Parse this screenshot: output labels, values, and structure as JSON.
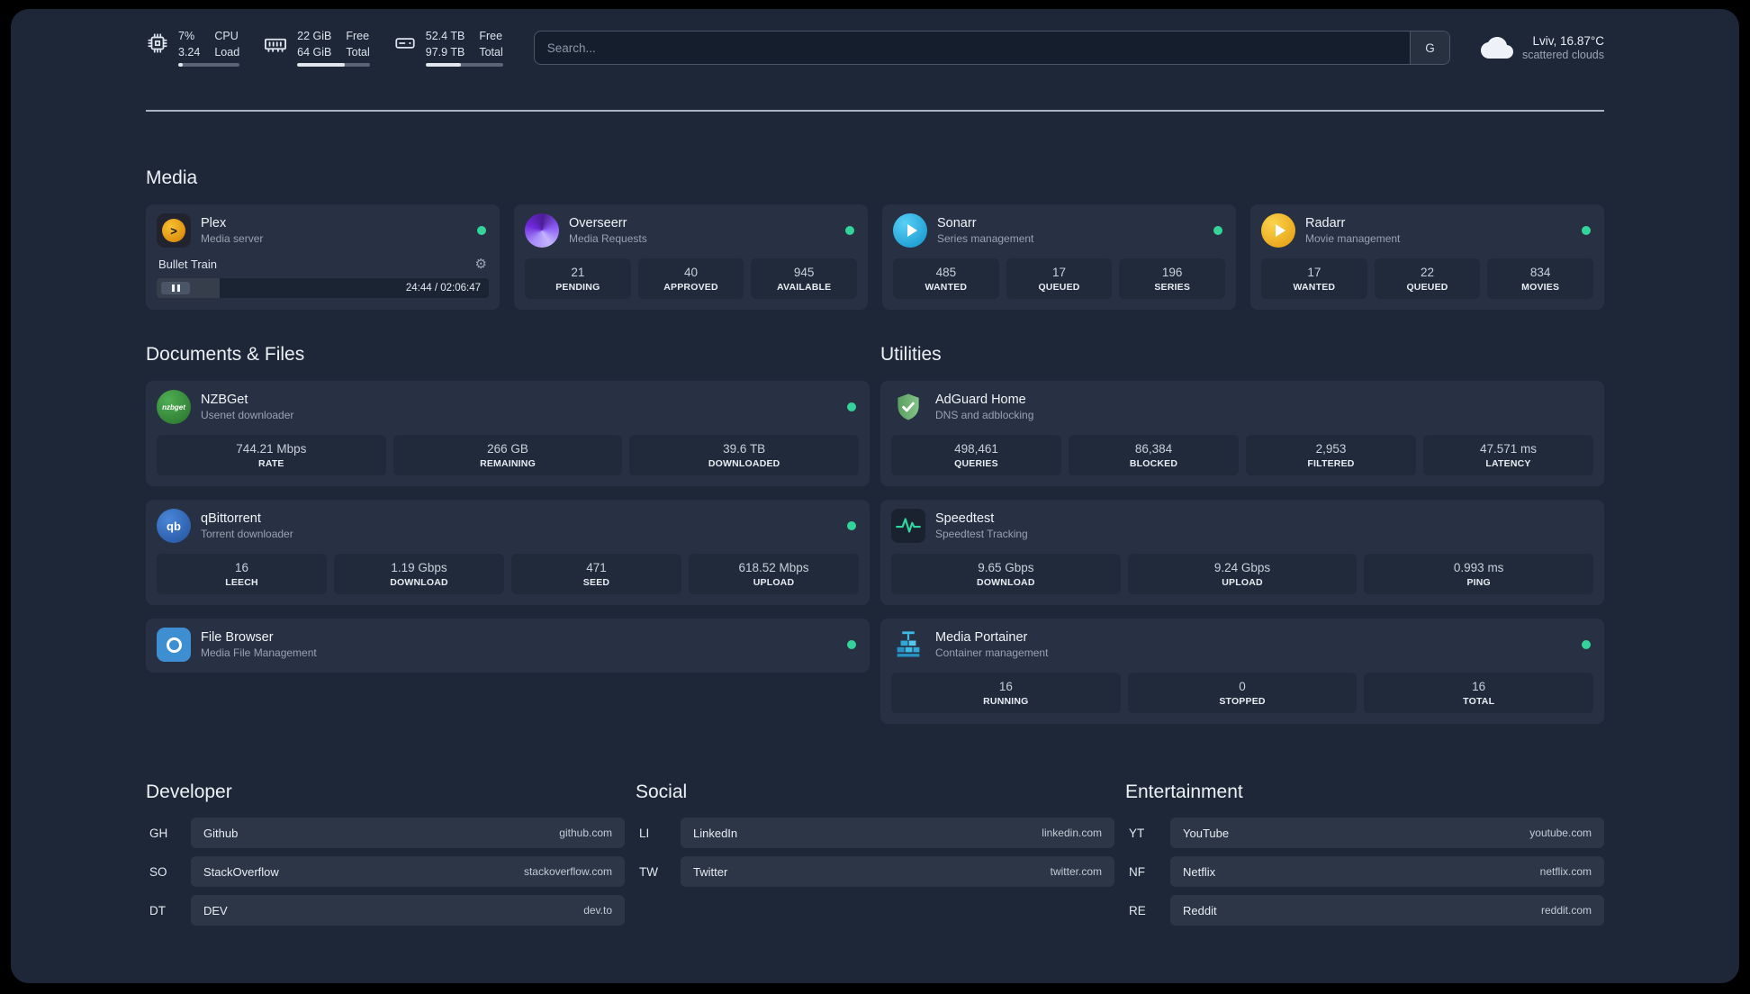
{
  "colors": {
    "status_online": "#34d399",
    "plex_accent": "#e5a00d",
    "overseerr_accent": "#7c3aed",
    "sonarr_accent": "#35c5f4",
    "radarr_accent": "#f7c51e",
    "nzbget_accent": "#43a047",
    "qbittorrent_accent": "#2f67ba",
    "filebrowser_accent": "#3d8fd1",
    "adguard_accent": "#68b279",
    "speedtest_accent": "#2fd6a2",
    "portainer_accent": "#3db9e5"
  },
  "topbar": {
    "cpu": {
      "value1": "7%",
      "value2": "3.24",
      "label1": "CPU",
      "label2": "Load",
      "bar_pct": 7
    },
    "memory": {
      "value1": "22 GiB",
      "value2": "64 GiB",
      "label1": "Free",
      "label2": "Total",
      "bar_pct": 66
    },
    "disk": {
      "value1": "52.4 TB",
      "value2": "97.9 TB",
      "label1": "Free",
      "label2": "Total",
      "bar_pct": 46
    },
    "search": {
      "placeholder": "Search...",
      "provider": "G"
    },
    "weather": {
      "location": "Lviv, 16.87°C",
      "condition": "scattered clouds"
    }
  },
  "media": {
    "title": "Media",
    "plex": {
      "name": "Plex",
      "desc": "Media server",
      "now_playing": "Bullet Train",
      "time": "24:44 / 02:06:47",
      "progress_pct": 19
    },
    "overseerr": {
      "name": "Overseerr",
      "desc": "Media Requests",
      "stats": [
        {
          "value": "21",
          "label": "PENDING"
        },
        {
          "value": "40",
          "label": "APPROVED"
        },
        {
          "value": "945",
          "label": "AVAILABLE"
        }
      ]
    },
    "sonarr": {
      "name": "Sonarr",
      "desc": "Series management",
      "stats": [
        {
          "value": "485",
          "label": "WANTED"
        },
        {
          "value": "17",
          "label": "QUEUED"
        },
        {
          "value": "196",
          "label": "SERIES"
        }
      ]
    },
    "radarr": {
      "name": "Radarr",
      "desc": "Movie management",
      "stats": [
        {
          "value": "17",
          "label": "WANTED"
        },
        {
          "value": "22",
          "label": "QUEUED"
        },
        {
          "value": "834",
          "label": "MOVIES"
        }
      ]
    }
  },
  "documents": {
    "title": "Documents & Files",
    "nzbget": {
      "name": "NZBGet",
      "desc": "Usenet downloader",
      "icon_text": "nzbget",
      "stats": [
        {
          "value": "744.21 Mbps",
          "label": "RATE"
        },
        {
          "value": "266 GB",
          "label": "REMAINING"
        },
        {
          "value": "39.6 TB",
          "label": "DOWNLOADED"
        }
      ]
    },
    "qbittorrent": {
      "name": "qBittorrent",
      "desc": "Torrent downloader",
      "icon_text": "qb",
      "stats": [
        {
          "value": "16",
          "label": "LEECH"
        },
        {
          "value": "1.19 Gbps",
          "label": "DOWNLOAD"
        },
        {
          "value": "471",
          "label": "SEED"
        },
        {
          "value": "618.52 Mbps",
          "label": "UPLOAD"
        }
      ]
    },
    "filebrowser": {
      "name": "File Browser",
      "desc": "Media File Management"
    }
  },
  "utilities": {
    "title": "Utilities",
    "adguard": {
      "name": "AdGuard Home",
      "desc": "DNS and adblocking",
      "stats": [
        {
          "value": "498,461",
          "label": "QUERIES"
        },
        {
          "value": "86,384",
          "label": "BLOCKED"
        },
        {
          "value": "2,953",
          "label": "FILTERED"
        },
        {
          "value": "47.571 ms",
          "label": "LATENCY"
        }
      ]
    },
    "speedtest": {
      "name": "Speedtest",
      "desc": "Speedtest Tracking",
      "stats": [
        {
          "value": "9.65 Gbps",
          "label": "DOWNLOAD"
        },
        {
          "value": "9.24 Gbps",
          "label": "UPLOAD"
        },
        {
          "value": "0.993 ms",
          "label": "PING"
        }
      ]
    },
    "portainer": {
      "name": "Media Portainer",
      "desc": "Container management",
      "stats": [
        {
          "value": "16",
          "label": "RUNNING"
        },
        {
          "value": "0",
          "label": "STOPPED"
        },
        {
          "value": "16",
          "label": "TOTAL"
        }
      ]
    }
  },
  "bookmarks": {
    "developer": {
      "title": "Developer",
      "items": [
        {
          "abbr": "GH",
          "name": "Github",
          "url": "github.com"
        },
        {
          "abbr": "SO",
          "name": "StackOverflow",
          "url": "stackoverflow.com"
        },
        {
          "abbr": "DT",
          "name": "DEV",
          "url": "dev.to"
        }
      ]
    },
    "social": {
      "title": "Social",
      "items": [
        {
          "abbr": "LI",
          "name": "LinkedIn",
          "url": "linkedin.com"
        },
        {
          "abbr": "TW",
          "name": "Twitter",
          "url": "twitter.com"
        }
      ]
    },
    "entertainment": {
      "title": "Entertainment",
      "items": [
        {
          "abbr": "YT",
          "name": "YouTube",
          "url": "youtube.com"
        },
        {
          "abbr": "NF",
          "name": "Netflix",
          "url": "netflix.com"
        },
        {
          "abbr": "RE",
          "name": "Reddit",
          "url": "reddit.com"
        }
      ]
    }
  }
}
